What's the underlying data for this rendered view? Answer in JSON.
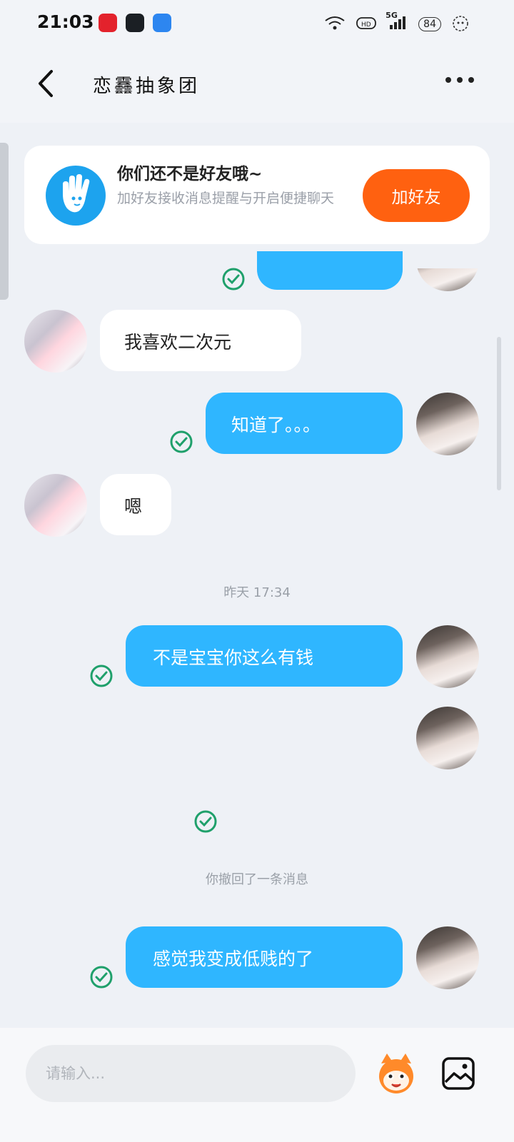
{
  "status_bar": {
    "time": "21:03",
    "signal": "5G",
    "battery": "84"
  },
  "header": {
    "title": "恋䨺抽象团",
    "back_icon": "chevron-left-icon",
    "more_icon": "more-dots-icon"
  },
  "friend_prompt": {
    "title": "你们还不是好友哦~",
    "subtitle": "加好友接收消息提醒与开启便捷聊天",
    "button": "加好友",
    "icon": "hand-wave-icon"
  },
  "messages": [
    {
      "side": "out",
      "text": "",
      "partial": true
    },
    {
      "side": "in",
      "text": "我喜欢二次元"
    },
    {
      "side": "out",
      "text": "知道了。。。"
    },
    {
      "side": "in",
      "text": "嗯"
    },
    {
      "side": "system",
      "text": "昨天 17:34"
    },
    {
      "side": "out",
      "text": "不是宝宝你这么有钱"
    },
    {
      "side": "out",
      "text": ""
    },
    {
      "side": "system",
      "text": "你撤回了一条消息"
    },
    {
      "side": "out",
      "text": "感觉我变成低贱的了"
    }
  ],
  "composer": {
    "placeholder": "请输入...",
    "emoji_icon": "mascot-emoji-icon",
    "image_icon": "image-icon"
  },
  "colors": {
    "bubble_out": "#2fb6ff",
    "add_button": "#ff6110",
    "check": "#1fa06b",
    "background": "#eef1f6"
  }
}
